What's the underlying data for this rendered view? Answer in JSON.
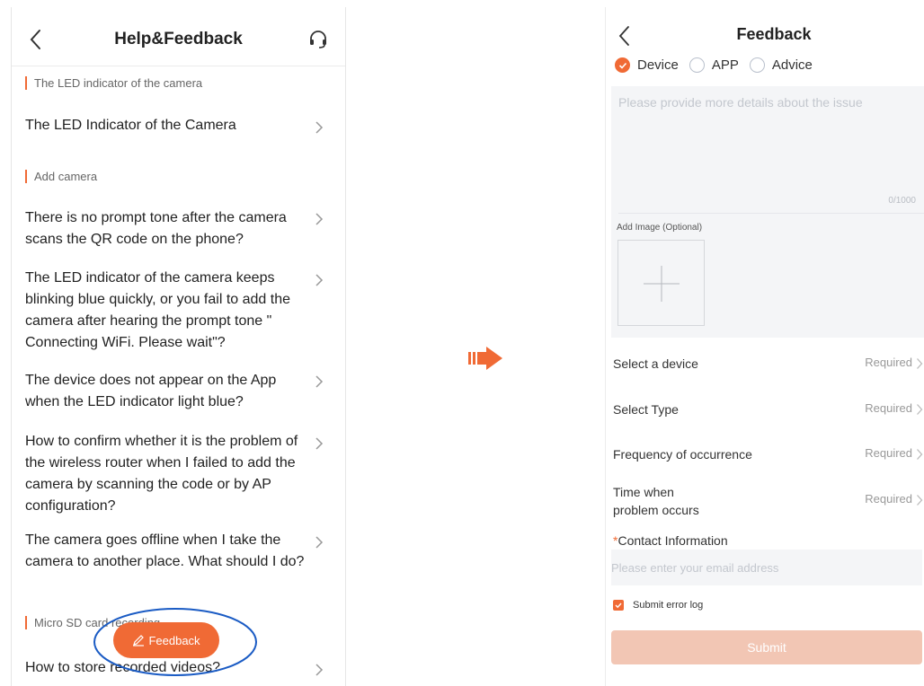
{
  "help_screen": {
    "title": "Help&Feedback",
    "sections": [
      {
        "heading": "The LED indicator of the camera"
      },
      {
        "heading": "Add camera"
      },
      {
        "heading": "Micro SD card recording"
      }
    ],
    "items": [
      "The LED Indicator of the Camera",
      "There is no prompt tone after the camera scans the QR code on the phone?",
      "The LED indicator of the camera keeps blinking blue quickly, or you fail to add the camera after hearing the prompt tone \" Connecting WiFi. Please wait\"?",
      "The device does not appear on the App when the LED indicator light blue?",
      "How to confirm whether it is the problem of the wireless router when I failed to add the camera by scanning the code or by AP configuration?",
      "The camera goes offline when I take the camera to another place. What should I do?",
      "How to store recorded videos?"
    ],
    "feedback_button": "Feedback"
  },
  "feedback_screen": {
    "title": "Feedback",
    "categories": [
      {
        "label": "Device",
        "selected": true
      },
      {
        "label": "APP",
        "selected": false
      },
      {
        "label": "Advice",
        "selected": false
      }
    ],
    "details_placeholder": "Please provide more details about the issue",
    "char_counter": "0/1000",
    "add_image_label": "Add Image (Optional)",
    "fields": [
      {
        "label": "Select a device",
        "value": "Required"
      },
      {
        "label": "Select Type",
        "value": "Required"
      },
      {
        "label": "Frequency of occurrence",
        "value": "Required"
      },
      {
        "label_line1": "Time when",
        "label_line2": "problem occurs",
        "value": "Required"
      }
    ],
    "contact": {
      "required_mark": "*",
      "label": "Contact Information",
      "placeholder": "Please enter your email address"
    },
    "submit_error_log": {
      "label": "Submit error log",
      "checked": true
    },
    "submit_button": "Submit"
  },
  "colors": {
    "accent": "#f06a35",
    "submit_disabled": "#f2c6b4",
    "highlight": "#1a5bc4"
  }
}
